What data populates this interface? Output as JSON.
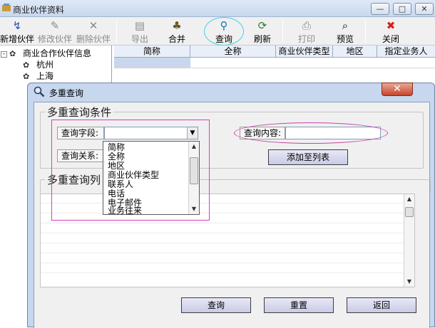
{
  "window": {
    "title": "商业伙伴资料",
    "min": "—",
    "max": "□",
    "close": "✕"
  },
  "toolbar": [
    {
      "id": "new",
      "label": "新增伙伴",
      "icon": "↯",
      "enabled": true
    },
    {
      "id": "edit",
      "label": "修改伙伴",
      "icon": "✎",
      "enabled": false
    },
    {
      "id": "delete",
      "label": "删除伙伴",
      "icon": "✕",
      "enabled": false
    },
    {
      "id": "export",
      "label": "导出",
      "icon": "▤",
      "enabled": false
    },
    {
      "id": "merge",
      "label": "合并",
      "icon": "♣",
      "enabled": true
    },
    {
      "id": "query",
      "label": "查询",
      "icon": "⚲",
      "enabled": true
    },
    {
      "id": "refresh",
      "label": "刷新",
      "icon": "⟳",
      "enabled": true
    },
    {
      "id": "print",
      "label": "打印",
      "icon": "⎙",
      "enabled": false
    },
    {
      "id": "preview",
      "label": "预览",
      "icon": "⌕",
      "enabled": true
    },
    {
      "id": "close",
      "label": "关闭",
      "icon": "✖",
      "enabled": true
    }
  ],
  "tree": {
    "root": "商业合作伙伴信息",
    "children": [
      "杭州",
      "上海"
    ]
  },
  "grid": {
    "columns": [
      "简称",
      "全称",
      "商业伙伴类型",
      "地区",
      "指定业务人"
    ]
  },
  "dialog": {
    "title": "多重查询",
    "close": "✕",
    "conditions_group": "多重查询条件",
    "field_label": "查询字段:",
    "relation_label": "查询关系:",
    "content_label": "查询内容:",
    "content_value": "",
    "add_button": "添加至列表",
    "list_group": "多重查询列",
    "dropdown_options": [
      "简称",
      "全称",
      "地区",
      "商业伙伴类型",
      "联系人",
      "电话",
      "电子邮件",
      "业务往来"
    ],
    "buttons": {
      "query": "查询",
      "reset": "重置",
      "back": "返回"
    }
  },
  "colors": {
    "dialog_frame": "#c6d7ee",
    "highlight_pink": "#d63cc4",
    "highlight_cyan": "#49d0e6",
    "close_red": "#c7432a"
  }
}
